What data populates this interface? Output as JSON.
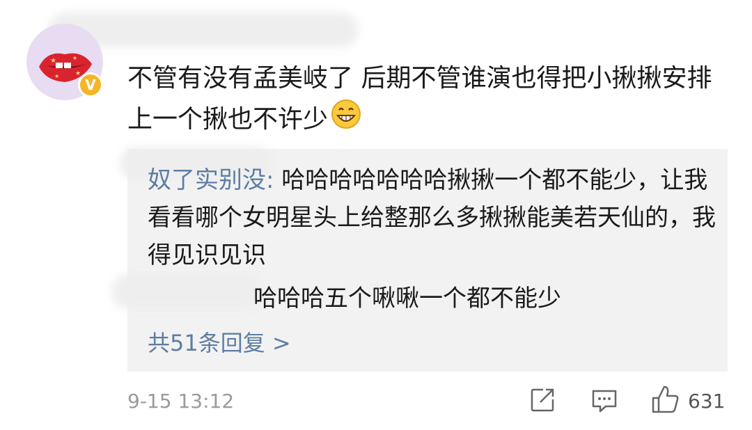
{
  "comment": {
    "text": "不管有没有孟美岐了 后期不管谁演也得把小揪揪安排上一个揪也不许少"
  },
  "replies": [
    {
      "username": "奴了实别没",
      "text": "哈哈哈哈哈哈哈揪揪一个都不能少，让我看看哪个女明星头上给整那么多揪揪能美若天仙的，我得见识见识"
    },
    {
      "text": "哈哈哈五个啾啾一个都不能少"
    }
  ],
  "more_replies": "共51条回复 >",
  "footer": {
    "time": "9-15 13:12",
    "like_count": "631"
  },
  "colors": {
    "link": "#5d7da3",
    "reply_bg": "#f2f2f2",
    "badge": "#f6b526"
  }
}
